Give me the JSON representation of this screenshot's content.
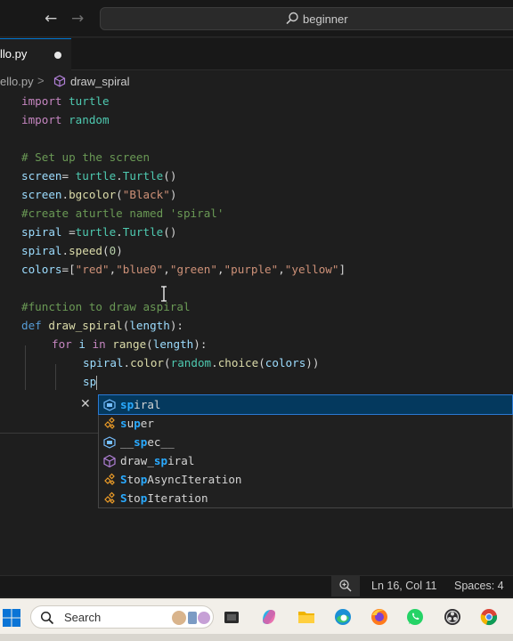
{
  "titlebar": {
    "back_icon": "arrow-left-icon",
    "forward_icon": "arrow-right-icon",
    "search_label": "beginner"
  },
  "tab": {
    "label": "llo.py",
    "dirty": true
  },
  "breadcrumb": {
    "file": "ello.py",
    "separator": ">",
    "symbol_icon": "cube-method-icon",
    "symbol": "draw_spiral"
  },
  "editor": {
    "lines": {
      "l1_kw": "import",
      "l1_mod": " turtle",
      "l2_kw": "import",
      "l2_mod": " random",
      "l4": "# Set up the screen",
      "l5_var": "screen",
      "l5_eq": "= ",
      "l5_mod": "turtle",
      "l5_dot": ".",
      "l5_cls": "Turtle",
      "l5_paren": "()",
      "l6_var": "screen",
      "l6_dot": ".",
      "l6_fn": "bgcolor",
      "l6_open": "(",
      "l6_str": "\"Black\"",
      "l6_close": ")",
      "l7": "#create aturtle named 'spiral'",
      "l8_var": "spiral",
      "l8_eq": " =",
      "l8_mod": "turtle",
      "l8_dot": ".",
      "l8_cls": "Turtle",
      "l8_paren": "()",
      "l9_var": "spiral",
      "l9_dot": ".",
      "l9_fn": "speed",
      "l9_open": "(",
      "l9_num": "0",
      "l9_close": ")",
      "l10_var": "colors",
      "l10_eq": "=[",
      "l10_s1": "\"red\"",
      "l10_c1": ",",
      "l10_s2": "\"blue0\"",
      "l10_c2": ",",
      "l10_s3": "\"green\"",
      "l10_c3": ",",
      "l10_s4": "\"purple\"",
      "l10_c4": ",",
      "l10_s5": "\"yellow\"",
      "l10_close": "]",
      "l12": "#function to draw aspiral",
      "l13_kw": "def",
      "l13_fn": " draw_spiral",
      "l13_open": "(",
      "l13_param": "length",
      "l13_close": "):",
      "l14_kw": "for",
      "l14_var": " i",
      "l14_in": " in",
      "l14_fn": " range",
      "l14_open": "(",
      "l14_param": "length",
      "l14_close": "):",
      "l15_var": "spiral",
      "l15_dot": ".",
      "l15_fn": "color",
      "l15_open": "(",
      "l15_mod": "random",
      "l15_dot2": ".",
      "l15_fn2": "choice",
      "l15_open2": "(",
      "l15_arg": "colors",
      "l15_close": "))",
      "l16_typed": "sp"
    }
  },
  "suggest": {
    "close_icon": "close-icon",
    "items": [
      {
        "icon": "variable-icon",
        "match": "sp",
        "rest": "iral"
      },
      {
        "icon": "class-icon",
        "match": "s",
        "rest": "u",
        "match2": "p",
        "rest2": "er"
      },
      {
        "icon": "variable-icon",
        "pre": "__",
        "match": "sp",
        "rest": "ec__"
      },
      {
        "icon": "method-cube-icon",
        "pre": "draw_",
        "match": "sp",
        "rest": "iral"
      },
      {
        "icon": "class-icon",
        "match": "S",
        "rest": "to",
        "match2": "p",
        "rest2": "AsyncIteration"
      },
      {
        "icon": "class-icon",
        "match": "S",
        "rest": "to",
        "match2": "p",
        "rest2": "Iteration"
      }
    ]
  },
  "statusbar": {
    "zoom_icon": "zoom-in-icon",
    "position": "Ln 16, Col 11",
    "spaces": "Spaces: 4"
  },
  "taskbar": {
    "start_icon": "windows-start-icon",
    "search_label": "Search",
    "apps": [
      "task-view-icon",
      "copilot-icon",
      "file-explorer-icon",
      "edge-icon",
      "firefox-icon",
      "whatsapp-icon",
      "obs-icon",
      "chrome-icon"
    ]
  }
}
